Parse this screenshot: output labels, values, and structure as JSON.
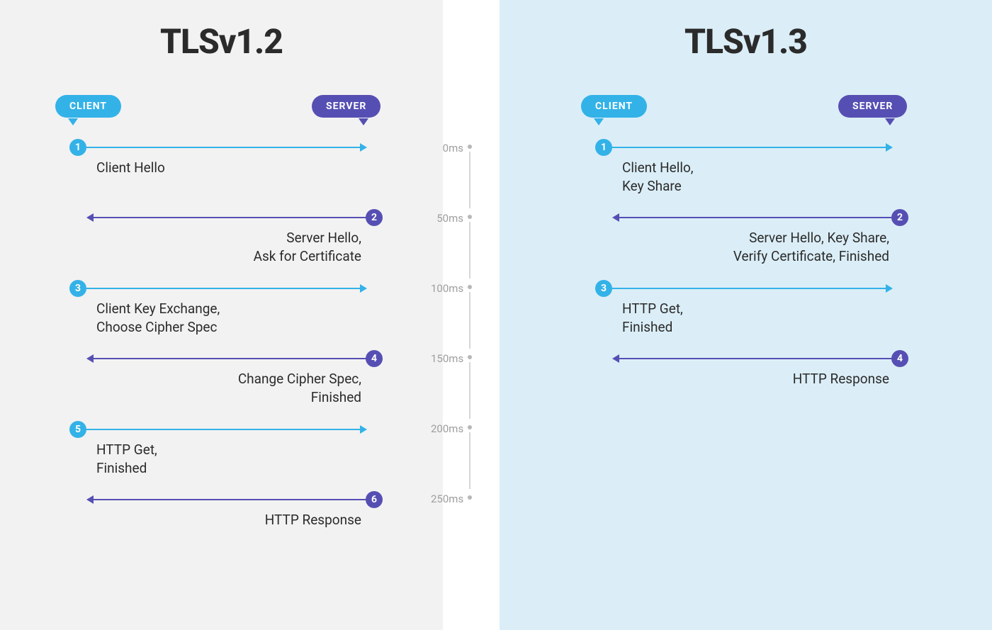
{
  "colors": {
    "client": "#33b2e8",
    "server": "#564fb3",
    "bg_left": "#f2f2f2",
    "bg_right": "#dbeef7"
  },
  "left": {
    "title": "TLSv1.2",
    "client_label": "CLIENT",
    "server_label": "SERVER",
    "steps": [
      {
        "n": "1",
        "dir": "right",
        "label": "Client Hello"
      },
      {
        "n": "2",
        "dir": "left",
        "label": "Server Hello,\nAsk for Certificate"
      },
      {
        "n": "3",
        "dir": "right",
        "label": "Client Key Exchange,\nChoose Cipher Spec"
      },
      {
        "n": "4",
        "dir": "left",
        "label": "Change Cipher Spec,\nFinished"
      },
      {
        "n": "5",
        "dir": "right",
        "label": "HTTP Get,\nFinished"
      },
      {
        "n": "6",
        "dir": "left",
        "label": "HTTP Response"
      }
    ]
  },
  "right": {
    "title": "TLSv1.3",
    "client_label": "CLIENT",
    "server_label": "SERVER",
    "steps": [
      {
        "n": "1",
        "dir": "right",
        "label": "Client Hello,\nKey Share"
      },
      {
        "n": "2",
        "dir": "left",
        "label": "Server Hello, Key Share,\nVerify Certificate, Finished"
      },
      {
        "n": "3",
        "dir": "right",
        "label": "HTTP Get,\nFinished"
      },
      {
        "n": "4",
        "dir": "left",
        "label": "HTTP Response"
      }
    ]
  },
  "timeline": {
    "ticks": [
      "0ms",
      "50ms",
      "100ms",
      "150ms",
      "200ms",
      "250ms"
    ]
  }
}
